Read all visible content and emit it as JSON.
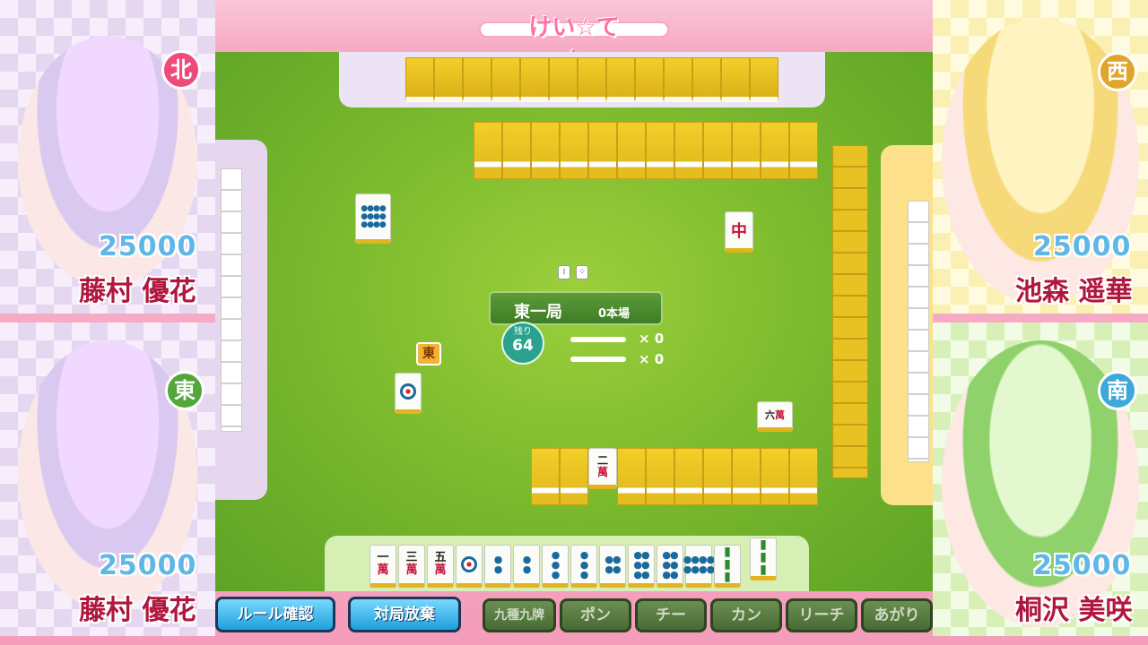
{
  "logo": "けい☆てん",
  "round": {
    "name": "東一局",
    "honba": "0本場"
  },
  "remaining": {
    "label": "残り",
    "count": "64"
  },
  "sticks": {
    "riichi_count": "× 0",
    "honba_count": "× 0"
  },
  "dealer_marker": "東",
  "players": {
    "north": {
      "wind": "北",
      "score": "25000",
      "name": "藤村 優花",
      "wind_color": "#ef4a7a"
    },
    "east": {
      "wind": "東",
      "score": "25000",
      "name": "藤村 優花",
      "wind_color": "#52a63a"
    },
    "west": {
      "wind": "西",
      "score": "25000",
      "name": "池森 遥華",
      "wind_color": "#e0a52a"
    },
    "south": {
      "wind": "南",
      "score": "25000",
      "name": "桐沢 美咲",
      "wind_color": "#3ea8d8"
    }
  },
  "discards": {
    "center_bottom": {
      "top": "二",
      "bottom": "萬"
    },
    "right_small": {
      "top": "六",
      "bottom": "萬"
    },
    "right_top": "中"
  },
  "hand": [
    {
      "top": "一",
      "bottom": "萬",
      "kind": "man"
    },
    {
      "top": "三",
      "bottom": "萬",
      "kind": "man"
    },
    {
      "top": "五",
      "bottom": "萬",
      "kind": "man"
    },
    {
      "kind": "pin1"
    },
    {
      "kind": "pin2"
    },
    {
      "kind": "pin2"
    },
    {
      "kind": "pin3"
    },
    {
      "kind": "pin3"
    },
    {
      "kind": "pin4"
    },
    {
      "kind": "pin6"
    },
    {
      "kind": "pin6"
    },
    {
      "kind": "pin8"
    },
    {
      "kind": "sou"
    },
    {
      "kind": "sou-drawn"
    }
  ],
  "buttons": {
    "rules": "ルール確認",
    "abandon": "対局放棄",
    "kyushu": "九種九牌",
    "pon": "ポン",
    "chi": "チー",
    "kan": "カン",
    "riichi": "リーチ",
    "agari": "あがり"
  }
}
